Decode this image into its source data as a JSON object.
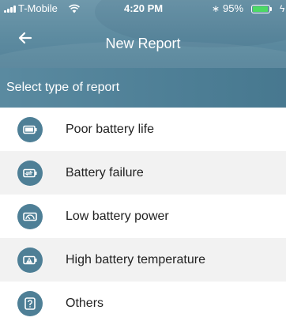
{
  "status_bar": {
    "carrier": "T-Mobile",
    "time": "4:20 PM",
    "battery_percent": "95%",
    "battery_level": 0.95,
    "bluetooth_glyph": "∗",
    "charging_glyph": "ϟ"
  },
  "header": {
    "title": "New Report",
    "back_icon": "arrow-left-icon"
  },
  "section": {
    "title": "Select type of report"
  },
  "report_types": [
    {
      "label": "Poor battery life",
      "icon": "battery-icon"
    },
    {
      "label": "Battery failure",
      "icon": "battery-swap-icon"
    },
    {
      "label": "Low battery power",
      "icon": "gauge-icon"
    },
    {
      "label": "High battery temperature",
      "icon": "battery-warning-icon"
    },
    {
      "label": "Others",
      "icon": "question-icon"
    }
  ],
  "colors": {
    "accent": "#4e7f96",
    "header_bg": "#5d8ba0",
    "row_alt_bg": "#f2f2f2",
    "battery_fill": "#4cd964"
  }
}
